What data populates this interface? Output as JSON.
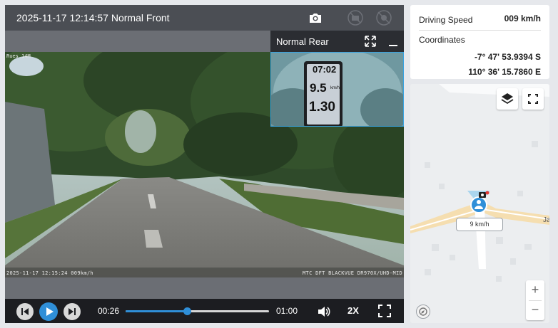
{
  "video": {
    "title": "2025-11-17 12:14:57 Normal Front",
    "overlay_top_left": "Rues 14M",
    "overlay_bottom_left": "2025-11-17 12:15:24 009km/h",
    "overlay_bottom_right": "MTC DFT BLACKVUE DR970X/UHD-MID",
    "rear_title": "Normal Rear",
    "rear_gps_readout": {
      "time": "07:02",
      "speed": "9.5",
      "distance": "1.30",
      "unit": "km/h"
    },
    "icons": {
      "snapshot": "camera-icon",
      "left_camera": "camera-swap-icon",
      "right_camera": "camera-off-icon"
    }
  },
  "playback": {
    "current_time": "00:26",
    "total_time": "01:00",
    "progress": 0.43,
    "speed": "2X",
    "accent_color": "#2f8fd8"
  },
  "info": {
    "driving_speed_label": "Driving Speed",
    "driving_speed_value": "009 km/h",
    "coordinates_label": "Coordinates",
    "latitude": "-7° 47' 53.9394 S",
    "longitude": "110° 36' 15.7860 E"
  },
  "map": {
    "speed_pill": "9 km/h",
    "edge_text": "Ja",
    "zoom_in": "+",
    "zoom_out": "−"
  }
}
